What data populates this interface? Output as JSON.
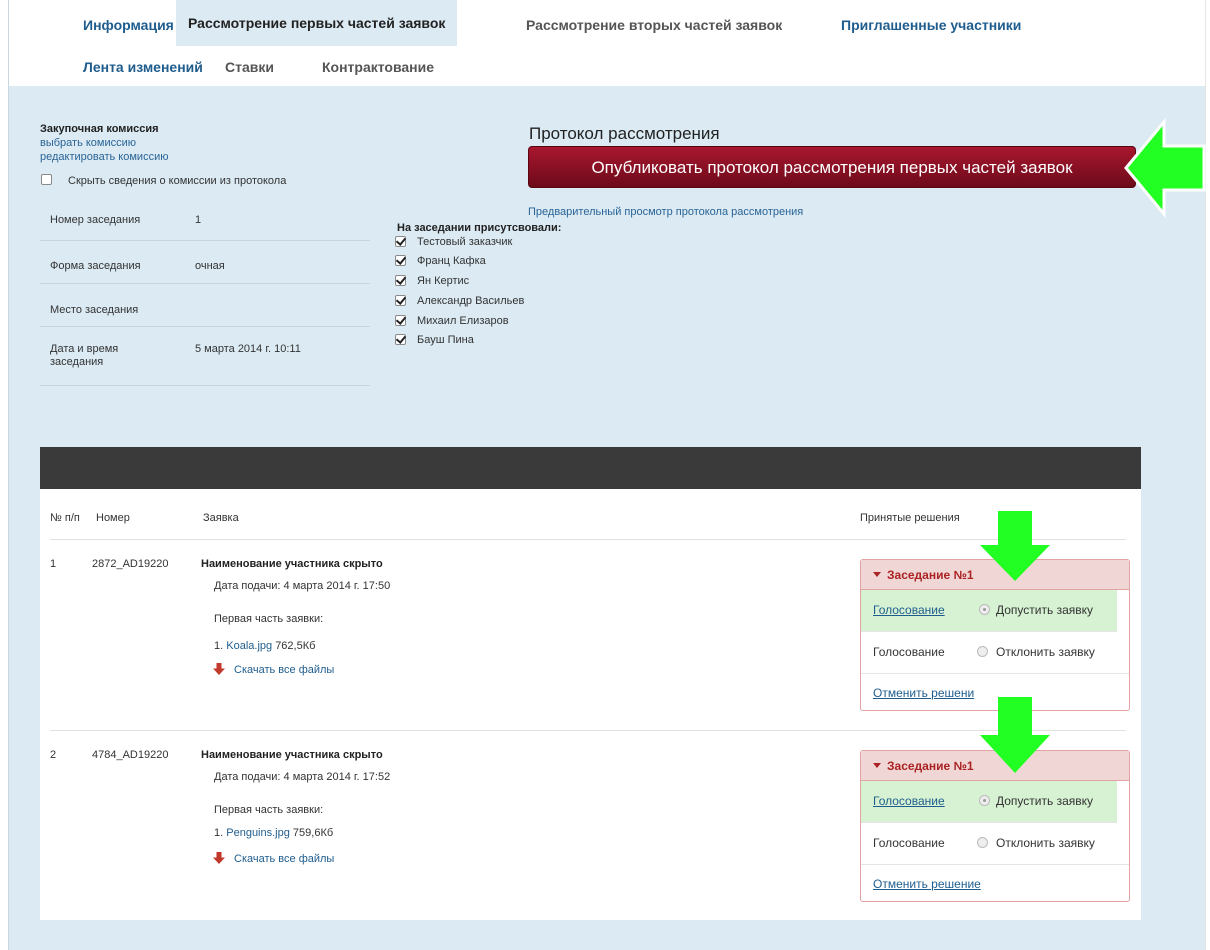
{
  "tabs": {
    "info": "Информация",
    "first_parts": "Рассмотрение первых частей заявок",
    "second_parts": "Рассмотрение вторых частей заявок",
    "invited": "Приглашенные участники",
    "feed": "Лента изменений",
    "bids": "Ставки",
    "contracting": "Контрактование"
  },
  "commission": {
    "title": "Закупочная комиссия",
    "select_link": "выбрать комиссию",
    "edit_link": "редактировать комиссию",
    "hide_label": "Скрыть сведения о комиссии из протокола"
  },
  "meeting": {
    "rows": [
      {
        "key": "Номер заседания",
        "value": "1"
      },
      {
        "key": "Форма заседания",
        "value": "очная"
      },
      {
        "key": "Место заседания",
        "value": ""
      },
      {
        "key": "Дата и время заседания",
        "value": "5 марта 2014 г. 10:11"
      }
    ]
  },
  "protocol": {
    "title": "Протокол рассмотрения",
    "publish_button": "Опубликовать протокол рассмотрения первых частей заявок",
    "preview_link": "Предварительный просмотр протокола рассмотрения"
  },
  "attendees": {
    "title": "На заседании присутсвовали:",
    "list": [
      "Тестовый заказчик",
      "Франц Кафка",
      "Ян Кертис",
      "Александр Васильев",
      "Михаил Елизаров",
      "Бауш Пина"
    ]
  },
  "table": {
    "headers": {
      "num": "№ п/п",
      "number": "Номер",
      "application": "Заявка",
      "decisions": "Принятые решения"
    },
    "rows": [
      {
        "num": "1",
        "number": "2872_AD19220",
        "participant": "Наименование участника скрыто",
        "date": "Дата подачи: 4 марта 2014 г. 17:50",
        "part_label": "Первая часть заявки:",
        "file_index": "1.",
        "file_name": "Koala.jpg",
        "file_size": "762,5Кб",
        "download": "Скачать все файлы",
        "meeting_title": "Заседание №1",
        "vote_link": "Голосование",
        "admit": "Допустить заявку",
        "vote_text": "Голосование",
        "reject": "Отклонить заявку",
        "cancel": "Отменить решени"
      },
      {
        "num": "2",
        "number": "4784_AD19220",
        "participant": "Наименование участника скрыто",
        "date": "Дата подачи: 4 марта 2014 г. 17:52",
        "part_label": "Первая часть заявки:",
        "file_index": "1.",
        "file_name": "Penguins.jpg",
        "file_size": "759,6Кб",
        "download": "Скачать все файлы",
        "meeting_title": "Заседание №1",
        "vote_link": "Голосование",
        "admit": "Допустить заявку",
        "vote_text": "Голосование",
        "reject": "Отклонить заявку",
        "cancel": "Отменить решение"
      }
    ]
  },
  "colors": {
    "accent_green": "#22ff22",
    "publish_red": "#8a1024",
    "panel_blue": "#dbeaf3"
  }
}
